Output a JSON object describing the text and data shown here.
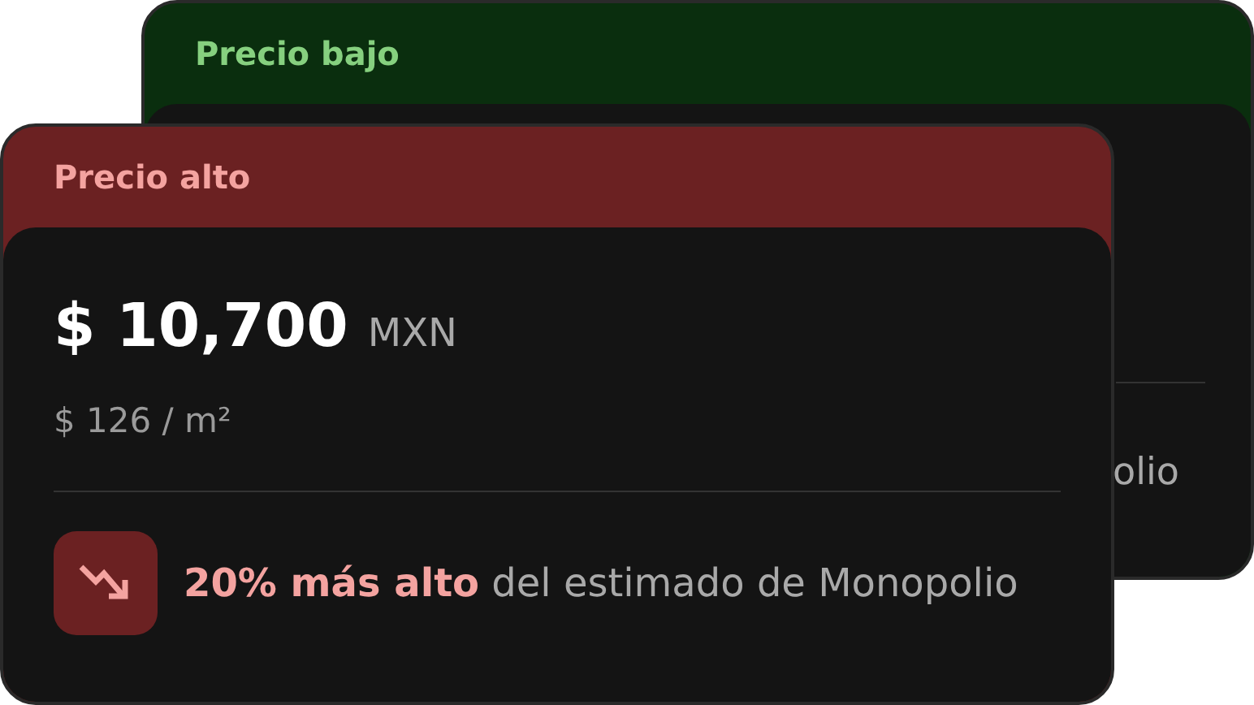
{
  "cards": [
    {
      "kind": "back",
      "title": "Precio bajo",
      "color": "#0a2e0e",
      "fragment": "olio"
    },
    {
      "kind": "front",
      "title": "Precio alto",
      "color": "#6b2122",
      "price": "$ 10,700",
      "currency": "MXN",
      "per_area": "$ 126 / m²",
      "note": "**20% más alto** del estimado de Monopolio"
    }
  ]
}
